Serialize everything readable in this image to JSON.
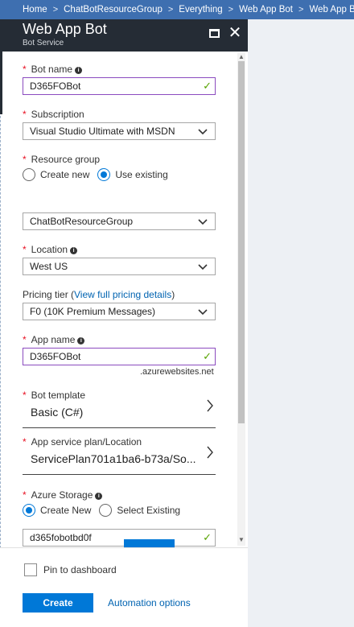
{
  "breadcrumb": {
    "items": [
      "Home",
      "ChatBotResourceGroup",
      "Everything",
      "Web App Bot"
    ],
    "current": "Web App Bot"
  },
  "blade": {
    "title": "Web App Bot",
    "subtitle": "Bot Service"
  },
  "form": {
    "bot_name": {
      "label": "Bot name",
      "value": "D365FOBot"
    },
    "subscription": {
      "label": "Subscription",
      "value": "Visual Studio Ultimate with MSDN"
    },
    "resource_group": {
      "label": "Resource group",
      "options": [
        "Create new",
        "Use existing"
      ],
      "selected": "Use existing",
      "value": "ChatBotResourceGroup"
    },
    "location": {
      "label": "Location",
      "value": "West US"
    },
    "pricing_tier": {
      "label": "Pricing tier (",
      "link": "View full pricing details",
      "label_end": ")",
      "value": "F0 (10K Premium Messages)"
    },
    "app_name": {
      "label": "App name",
      "value": "D365FOBot",
      "suffix": ".azurewebsites.net"
    },
    "bot_template": {
      "label": "Bot template",
      "value": "Basic (C#)"
    },
    "app_service_plan": {
      "label": "App service plan/Location",
      "value": "ServicePlan701a1ba6-b73a/So..."
    },
    "azure_storage": {
      "label": "Azure Storage",
      "options": [
        "Create New",
        "Select Existing"
      ],
      "selected": "Create New",
      "value": "d365fobotbd0f"
    }
  },
  "footer": {
    "pin_label": "Pin to dashboard",
    "pin_checked": false,
    "create_label": "Create",
    "automation_label": "Automation options"
  },
  "icons": {
    "maximize": "maximize-icon",
    "close": "close-icon",
    "info": "info-icon",
    "check": "checkmark-icon",
    "chevron": "chevron-down-icon",
    "arrow": "chevron-right-icon"
  },
  "colors": {
    "breadcrumb_bg": "#3e6fb0",
    "header_bg": "#252c35",
    "accent": "#0078d7",
    "required": "#e81123",
    "valid": "#57a300",
    "input_border_valid": "#8b4bbf"
  }
}
